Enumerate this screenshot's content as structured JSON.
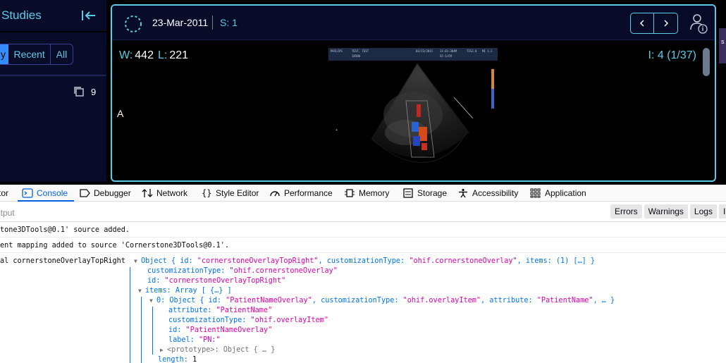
{
  "sidebar": {
    "title": "Studies",
    "tabs": [
      {
        "label": "y"
      },
      {
        "label": "Recent"
      },
      {
        "label": "All"
      }
    ],
    "study_count": "9"
  },
  "viewport": {
    "date": "23-Mar-2011",
    "series": "S: 1",
    "window": "W:",
    "window_value": "442",
    "level": "L:",
    "level_value": "221",
    "instance": "I: 4 (1/37)",
    "orientation": "A",
    "us_banner": [
      "PHILIPS",
      "TEST, TEST",
      "18500",
      "03/23/2011",
      "11:01:36AM",
      "TIS2.0",
      "MI 1.2",
      "S5-1/CM"
    ]
  },
  "right_edge": "s",
  "devtools": {
    "tabs": [
      {
        "label": "tor",
        "icon": "inspector-icon"
      },
      {
        "label": "Console",
        "icon": "console-icon"
      },
      {
        "label": "Debugger",
        "icon": "debugger-icon"
      },
      {
        "label": "Network",
        "icon": "network-icon"
      },
      {
        "label": "Style Editor",
        "icon": "style-editor-icon"
      },
      {
        "label": "Performance",
        "icon": "performance-icon"
      },
      {
        "label": "Memory",
        "icon": "memory-icon"
      },
      {
        "label": "Storage",
        "icon": "storage-icon"
      },
      {
        "label": "Accessibility",
        "icon": "accessibility-icon"
      },
      {
        "label": "Application",
        "icon": "application-icon"
      }
    ],
    "filter_placeholder": "utput",
    "filter_buttons": [
      "Errors",
      "Warnings",
      "Logs",
      "In"
    ],
    "logs": [
      "tone3DTools@0.1' source added.",
      "ent mapping added to source 'Cornerstone3DTools@0.1'."
    ],
    "object_log": {
      "prefix": "al cornerstoneOverlayTopRight",
      "summary": {
        "head": "Object { id: ",
        "id": "\"cornerstoneOverlayTopRight\"",
        "mid": ", customizationType: ",
        "type": "\"ohif.cornerstoneOverlay\"",
        "tail": ", items: (1) […] }"
      },
      "props": [
        {
          "key": "customizationType: ",
          "value": "\"ohif.cornerstoneOverlay\""
        },
        {
          "key": "id: ",
          "value": "\"cornerstoneOverlayTopRight\""
        }
      ],
      "items_line": "items: Array [ {…} ]",
      "item0": {
        "head": "0: Object { id: ",
        "id": "\"PatientNameOverlay\"",
        "mid": ", customizationType: ",
        "type": "\"ohif.overlayItem\"",
        "mid2": ", attribute: ",
        "attr": "\"PatientName\"",
        "tail": ", … }"
      },
      "item0_props": [
        {
          "key": "attribute: ",
          "value": "\"PatientName\""
        },
        {
          "key": "customizationType: ",
          "value": "\"ohif.overlayItem\""
        },
        {
          "key": "id: ",
          "value": "\"PatientNameOverlay\""
        },
        {
          "key": "label: ",
          "value": "\"PN:\""
        }
      ],
      "prototype": "<prototype>: Object { … }",
      "length": {
        "key": "length: ",
        "value": "1"
      }
    }
  },
  "colors": {
    "accent": "#5acce6",
    "primary": "#348cfd",
    "panel": "#090c29",
    "devtools_blue": "#0060df"
  }
}
